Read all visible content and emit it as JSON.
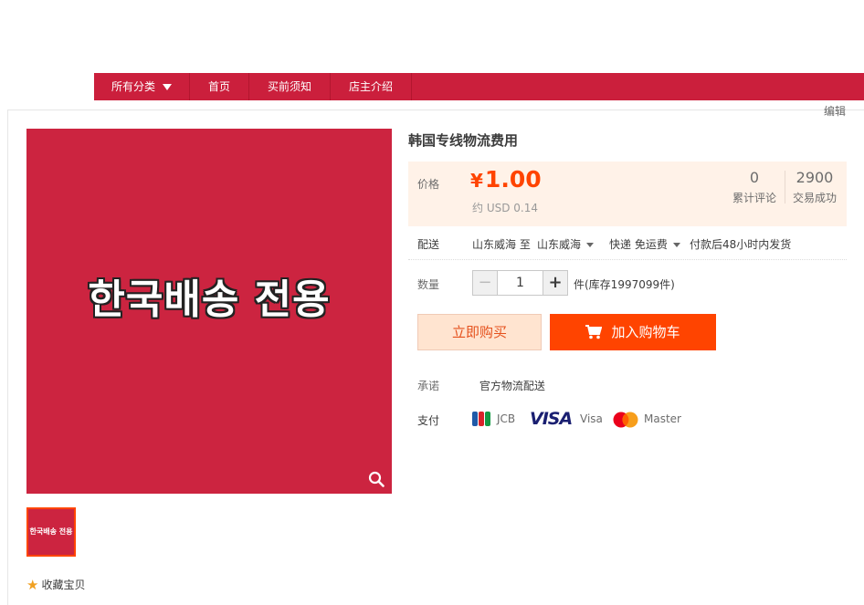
{
  "nav": {
    "items": [
      {
        "label": "所有分类"
      },
      {
        "label": "首页"
      },
      {
        "label": "买前须知"
      },
      {
        "label": "店主介绍"
      }
    ]
  },
  "edit_label": "编辑",
  "gallery": {
    "main_image_text": "한국배송 전용",
    "thumb_text": "한국배송 전용",
    "favorite_label": "收藏宝贝"
  },
  "product": {
    "title": "韩国专线物流费用",
    "price_label": "价格",
    "currency": "¥",
    "price": "1.00",
    "usd": "约 USD 0.14",
    "stats": [
      {
        "value": "0",
        "label": "累计评论"
      },
      {
        "value": "2900",
        "label": "交易成功"
      }
    ]
  },
  "shipping": {
    "label": "配送",
    "from": "山东威海 至",
    "to": "山东威海",
    "method": "快递 免运费",
    "delivery": "付款后48小时内发货"
  },
  "quantity": {
    "label": "数量",
    "minus": "−",
    "value": "1",
    "plus": "+",
    "stock": "件(库存1997099件)"
  },
  "actions": {
    "buy_now": "立即购买",
    "add_to_cart": "加入购物车"
  },
  "promise": {
    "label": "承诺",
    "text": "官方物流配送"
  },
  "payment": {
    "label": "支付",
    "methods": [
      {
        "name": "JCB"
      },
      {
        "logo": "VISA",
        "name": "Visa"
      },
      {
        "name": "Master"
      }
    ]
  },
  "colors": {
    "brand_red": "#cb1f3c",
    "accent_orange": "#ff4400",
    "price_orange": "#ff4400"
  }
}
